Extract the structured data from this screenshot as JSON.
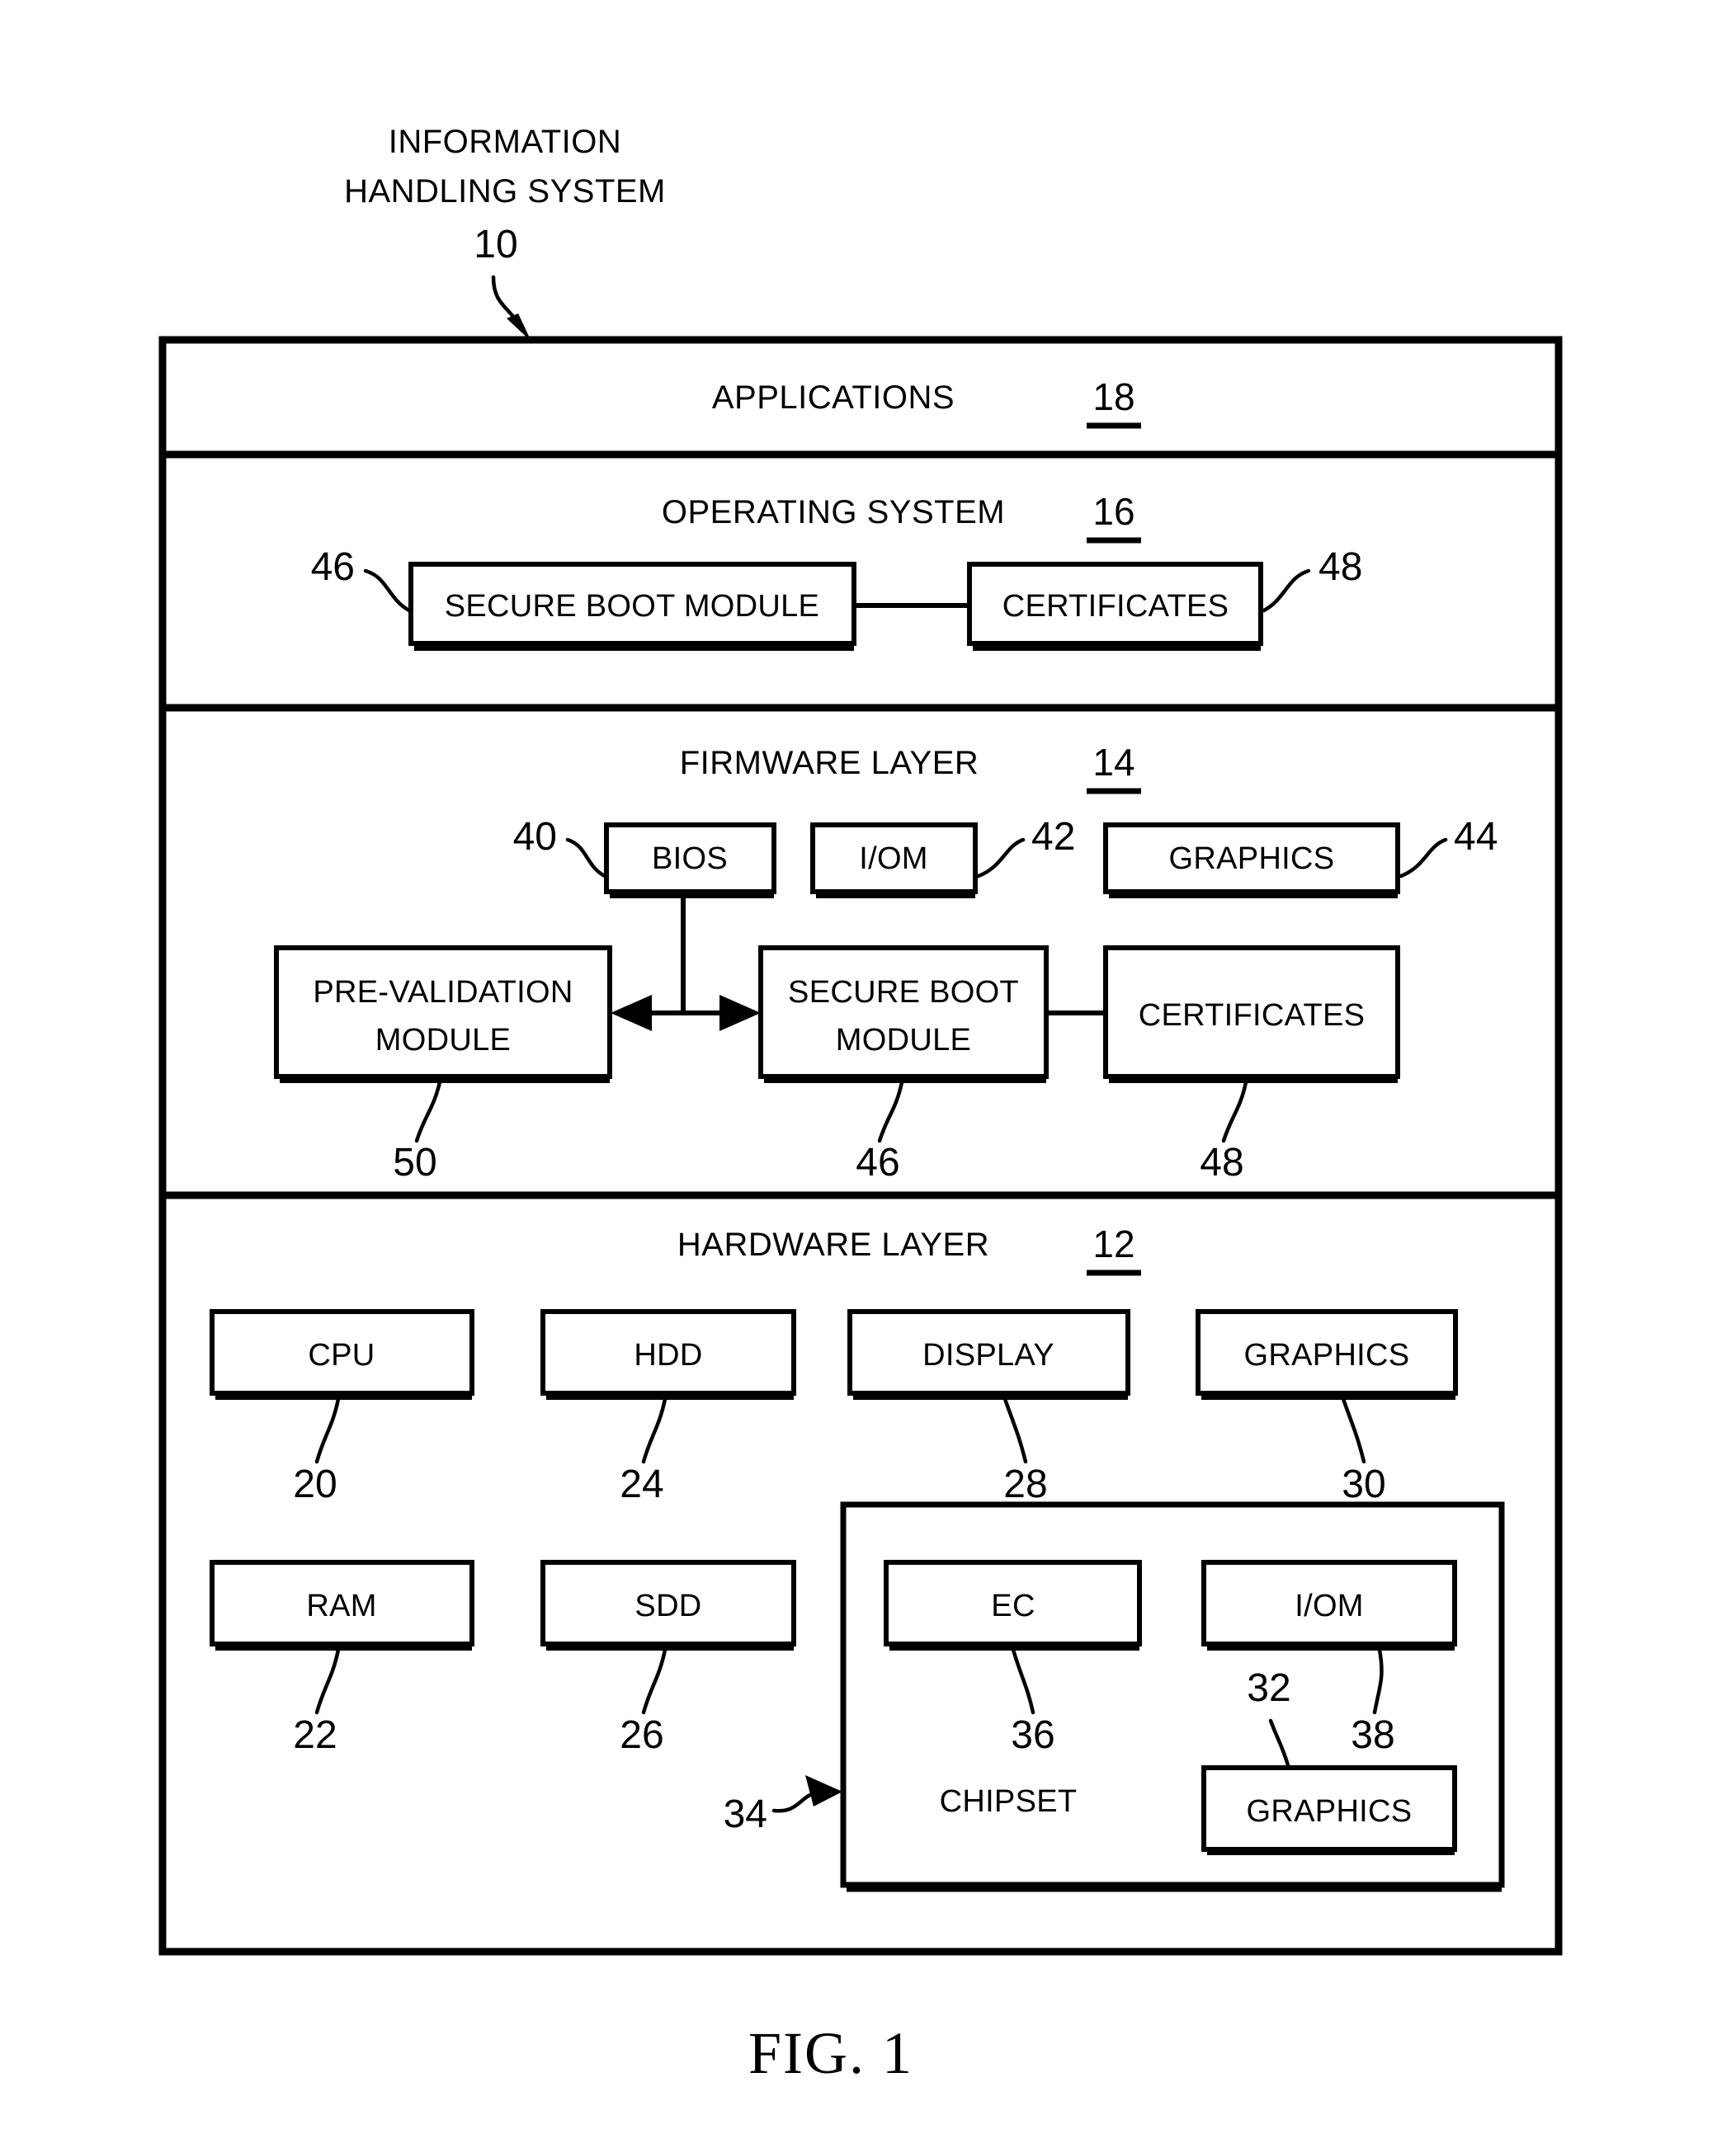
{
  "figure": {
    "caption": "FIG. 1",
    "system_title_line1": "INFORMATION",
    "system_title_line2": "HANDLING SYSTEM",
    "system_ref": "10"
  },
  "layers": [
    {
      "key": "applications",
      "title": "APPLICATIONS",
      "ref": "18"
    },
    {
      "key": "operating_system",
      "title": "OPERATING SYSTEM",
      "ref": "16"
    },
    {
      "key": "firmware",
      "title": "FIRMWARE LAYER",
      "ref": "14"
    },
    {
      "key": "hardware",
      "title": "HARDWARE LAYER",
      "ref": "12"
    }
  ],
  "os_blocks": [
    {
      "label": "SECURE BOOT MODULE",
      "ref": "46"
    },
    {
      "label": "CERTIFICATES",
      "ref": "48"
    }
  ],
  "firmware_blocks_row1": [
    {
      "label": "BIOS",
      "ref": "40"
    },
    {
      "label": "I/OM",
      "ref": "42"
    },
    {
      "label": "GRAPHICS",
      "ref": "44"
    }
  ],
  "firmware_blocks_row2": [
    {
      "label_line1": "PRE-VALIDATION",
      "label_line2": "MODULE",
      "ref": "50"
    },
    {
      "label_line1": "SECURE BOOT",
      "label_line2": "MODULE",
      "ref": "46"
    },
    {
      "label_line1": "CERTIFICATES",
      "label_line2": "",
      "ref": "48"
    }
  ],
  "hardware_blocks_row1": [
    {
      "label": "CPU",
      "ref": "20"
    },
    {
      "label": "HDD",
      "ref": "24"
    },
    {
      "label": "DISPLAY",
      "ref": "28"
    },
    {
      "label": "GRAPHICS",
      "ref": "30"
    }
  ],
  "hardware_blocks_row2": [
    {
      "label": "RAM",
      "ref": "22"
    },
    {
      "label": "SDD",
      "ref": "26"
    }
  ],
  "chipset": {
    "label": "CHIPSET",
    "ref": "34",
    "blocks": [
      {
        "label": "EC",
        "ref": "36"
      },
      {
        "label": "I/OM",
        "ref": "38"
      },
      {
        "label": "GRAPHICS",
        "ref": "32"
      }
    ]
  },
  "colors": {
    "ink": "#000000",
    "paper": "#ffffff"
  }
}
